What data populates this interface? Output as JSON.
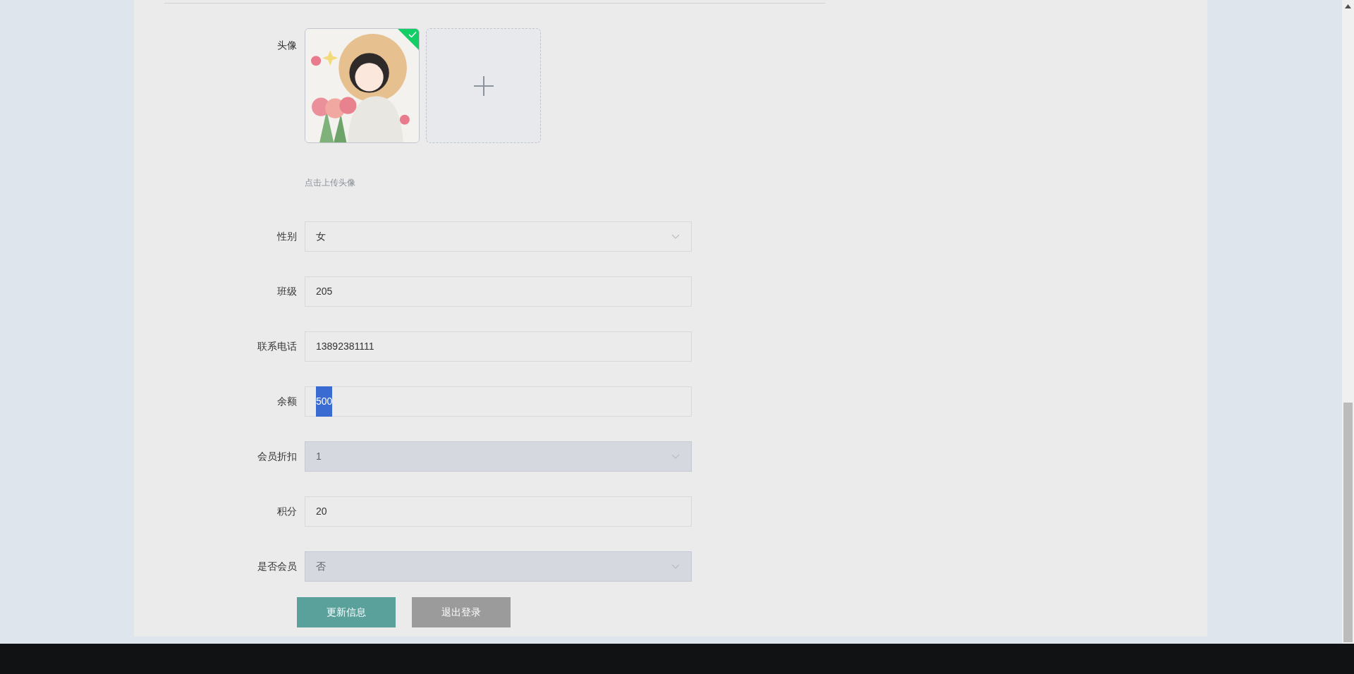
{
  "avatar": {
    "label": "头像",
    "uploaded": true,
    "hint": "点击上传头像"
  },
  "fields": [
    {
      "label": "性别",
      "kind": "select",
      "value": "女",
      "disabled": false,
      "text_selected": false
    },
    {
      "label": "班级",
      "kind": "input",
      "value": "205",
      "disabled": false,
      "text_selected": false
    },
    {
      "label": "联系电话",
      "kind": "input",
      "value": "13892381111",
      "disabled": false,
      "text_selected": false
    },
    {
      "label": "余额",
      "kind": "input",
      "value": "500",
      "disabled": false,
      "text_selected": true
    },
    {
      "label": "会员折扣",
      "kind": "select",
      "value": "1",
      "disabled": true,
      "text_selected": false
    },
    {
      "label": "积分",
      "kind": "input",
      "value": "20",
      "disabled": false,
      "text_selected": false
    },
    {
      "label": "是否会员",
      "kind": "select",
      "value": "否",
      "disabled": true,
      "text_selected": false
    }
  ],
  "buttons": [
    {
      "label": "更新信息",
      "kind": "primary"
    },
    {
      "label": "退出登录",
      "kind": "secondary"
    }
  ]
}
